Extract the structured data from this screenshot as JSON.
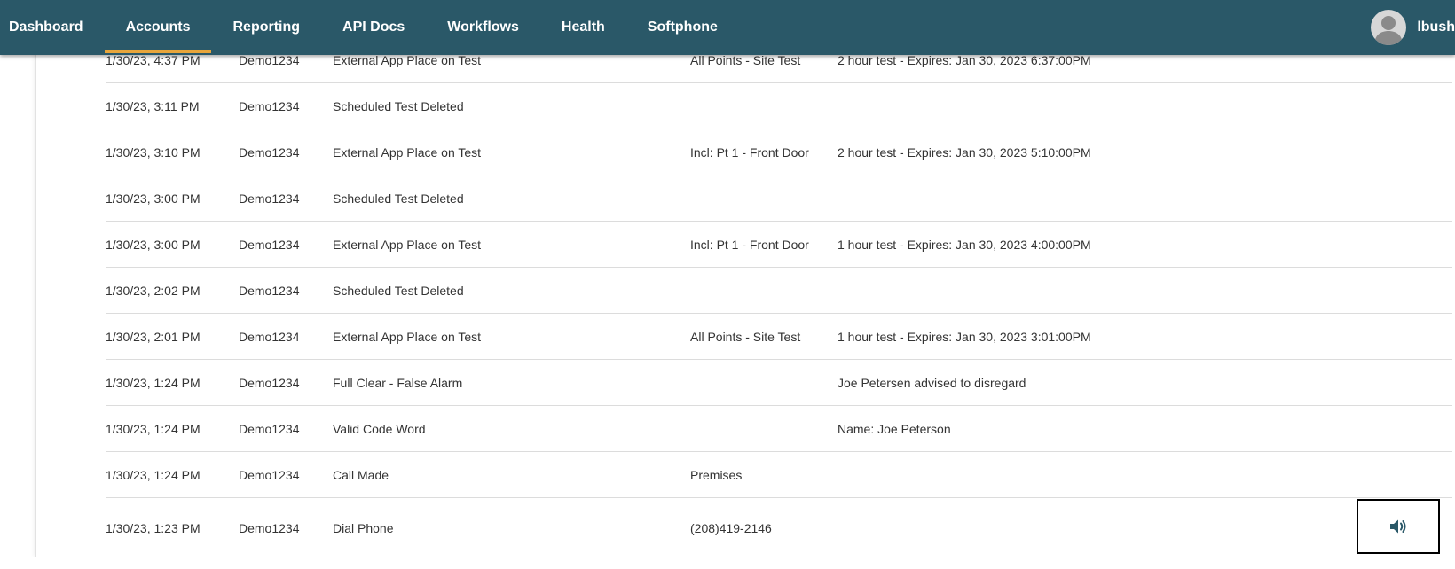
{
  "nav": {
    "items": [
      {
        "label": "Dashboard"
      },
      {
        "label": "Accounts"
      },
      {
        "label": "Reporting"
      },
      {
        "label": "API Docs"
      },
      {
        "label": "Workflows"
      },
      {
        "label": "Health"
      },
      {
        "label": "Softphone"
      }
    ],
    "active": "Accounts",
    "accent_color": "#e8a53b",
    "bar_color": "#2a5868"
  },
  "user": {
    "name": "lbush",
    "avatar_icon": "user-silhouette-icon"
  },
  "log": {
    "rows": [
      {
        "time": "1/30/23, 4:37 PM",
        "user": "Demo1234",
        "event": "External App Place on Test",
        "zone": "All Points - Site Test",
        "detail": "2 hour test - Expires: Jan 30, 2023 6:37:00PM"
      },
      {
        "time": "1/30/23, 3:11 PM",
        "user": "Demo1234",
        "event": "Scheduled Test Deleted",
        "zone": "",
        "detail": ""
      },
      {
        "time": "1/30/23, 3:10 PM",
        "user": "Demo1234",
        "event": "External App Place on Test",
        "zone": "Incl: Pt 1 - Front Door",
        "detail": "2 hour test - Expires: Jan 30, 2023 5:10:00PM"
      },
      {
        "time": "1/30/23, 3:00 PM",
        "user": "Demo1234",
        "event": "Scheduled Test Deleted",
        "zone": "",
        "detail": ""
      },
      {
        "time": "1/30/23, 3:00 PM",
        "user": "Demo1234",
        "event": "External App Place on Test",
        "zone": "Incl: Pt 1 - Front Door",
        "detail": "1 hour test - Expires: Jan 30, 2023 4:00:00PM"
      },
      {
        "time": "1/30/23, 2:02 PM",
        "user": "Demo1234",
        "event": "Scheduled Test Deleted",
        "zone": "",
        "detail": ""
      },
      {
        "time": "1/30/23, 2:01 PM",
        "user": "Demo1234",
        "event": "External App Place on Test",
        "zone": "All Points - Site Test",
        "detail": "1 hour test - Expires: Jan 30, 2023 3:01:00PM"
      },
      {
        "time": "1/30/23, 1:24 PM",
        "user": "Demo1234",
        "event": "Full Clear - False Alarm",
        "zone": "",
        "detail": "Joe Petersen advised to disregard"
      },
      {
        "time": "1/30/23, 1:24 PM",
        "user": "Demo1234",
        "event": "Valid Code Word",
        "zone": "",
        "detail": "Name: Joe Peterson"
      },
      {
        "time": "1/30/23, 1:24 PM",
        "user": "Demo1234",
        "event": "Call Made",
        "zone": "Premises",
        "detail": ""
      },
      {
        "time": "1/30/23, 1:23 PM",
        "user": "Demo1234",
        "event": "Dial Phone",
        "zone": "(208)419-2146",
        "detail": "",
        "action_icon": "speaker-volume-icon"
      }
    ]
  }
}
